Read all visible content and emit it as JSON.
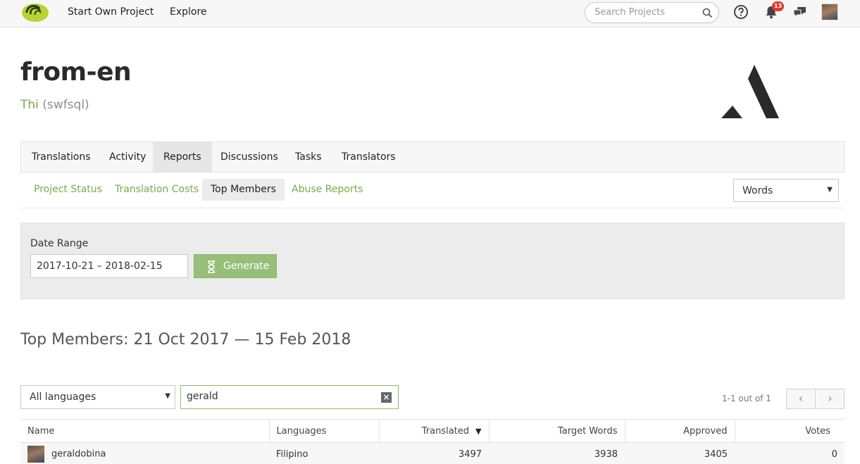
{
  "nav": {
    "start_own_project": "Start Own Project",
    "explore": "Explore",
    "search_placeholder": "Search Projects",
    "notification_count": "13"
  },
  "project": {
    "title": "from-en",
    "owner_name": "Thi",
    "owner_handle": "(swfsql)"
  },
  "main_tabs": [
    "Translations",
    "Activity",
    "Reports",
    "Discussions",
    "Tasks",
    "Translators"
  ],
  "main_tabs_active": "Reports",
  "sub_tabs": [
    "Project Status",
    "Translation Costs",
    "Top Members",
    "Abuse Reports"
  ],
  "sub_tabs_active": "Top Members",
  "metric_select": "Words",
  "date_range": {
    "label": "Date Range",
    "value": "2017-10-21 – 2018-02-15",
    "button": "Generate"
  },
  "report": {
    "heading": "Top Members: 21 Oct 2017 — 15 Feb 2018",
    "language_filter": "All languages",
    "member_filter": "gerald",
    "pager_text": "1-1 out of 1"
  },
  "table": {
    "columns": [
      "Name",
      "Languages",
      "Translated",
      "Target Words",
      "Approved",
      "Votes"
    ],
    "rows": [
      {
        "name": "geraldobina",
        "languages": "Filipino",
        "translated": "3497",
        "target_words": "3938",
        "approved": "3405",
        "votes": "0"
      }
    ]
  },
  "colors": {
    "accent_green": "#7aaa4c",
    "button_green": "#97bf79",
    "badge_red": "#e0392f"
  }
}
